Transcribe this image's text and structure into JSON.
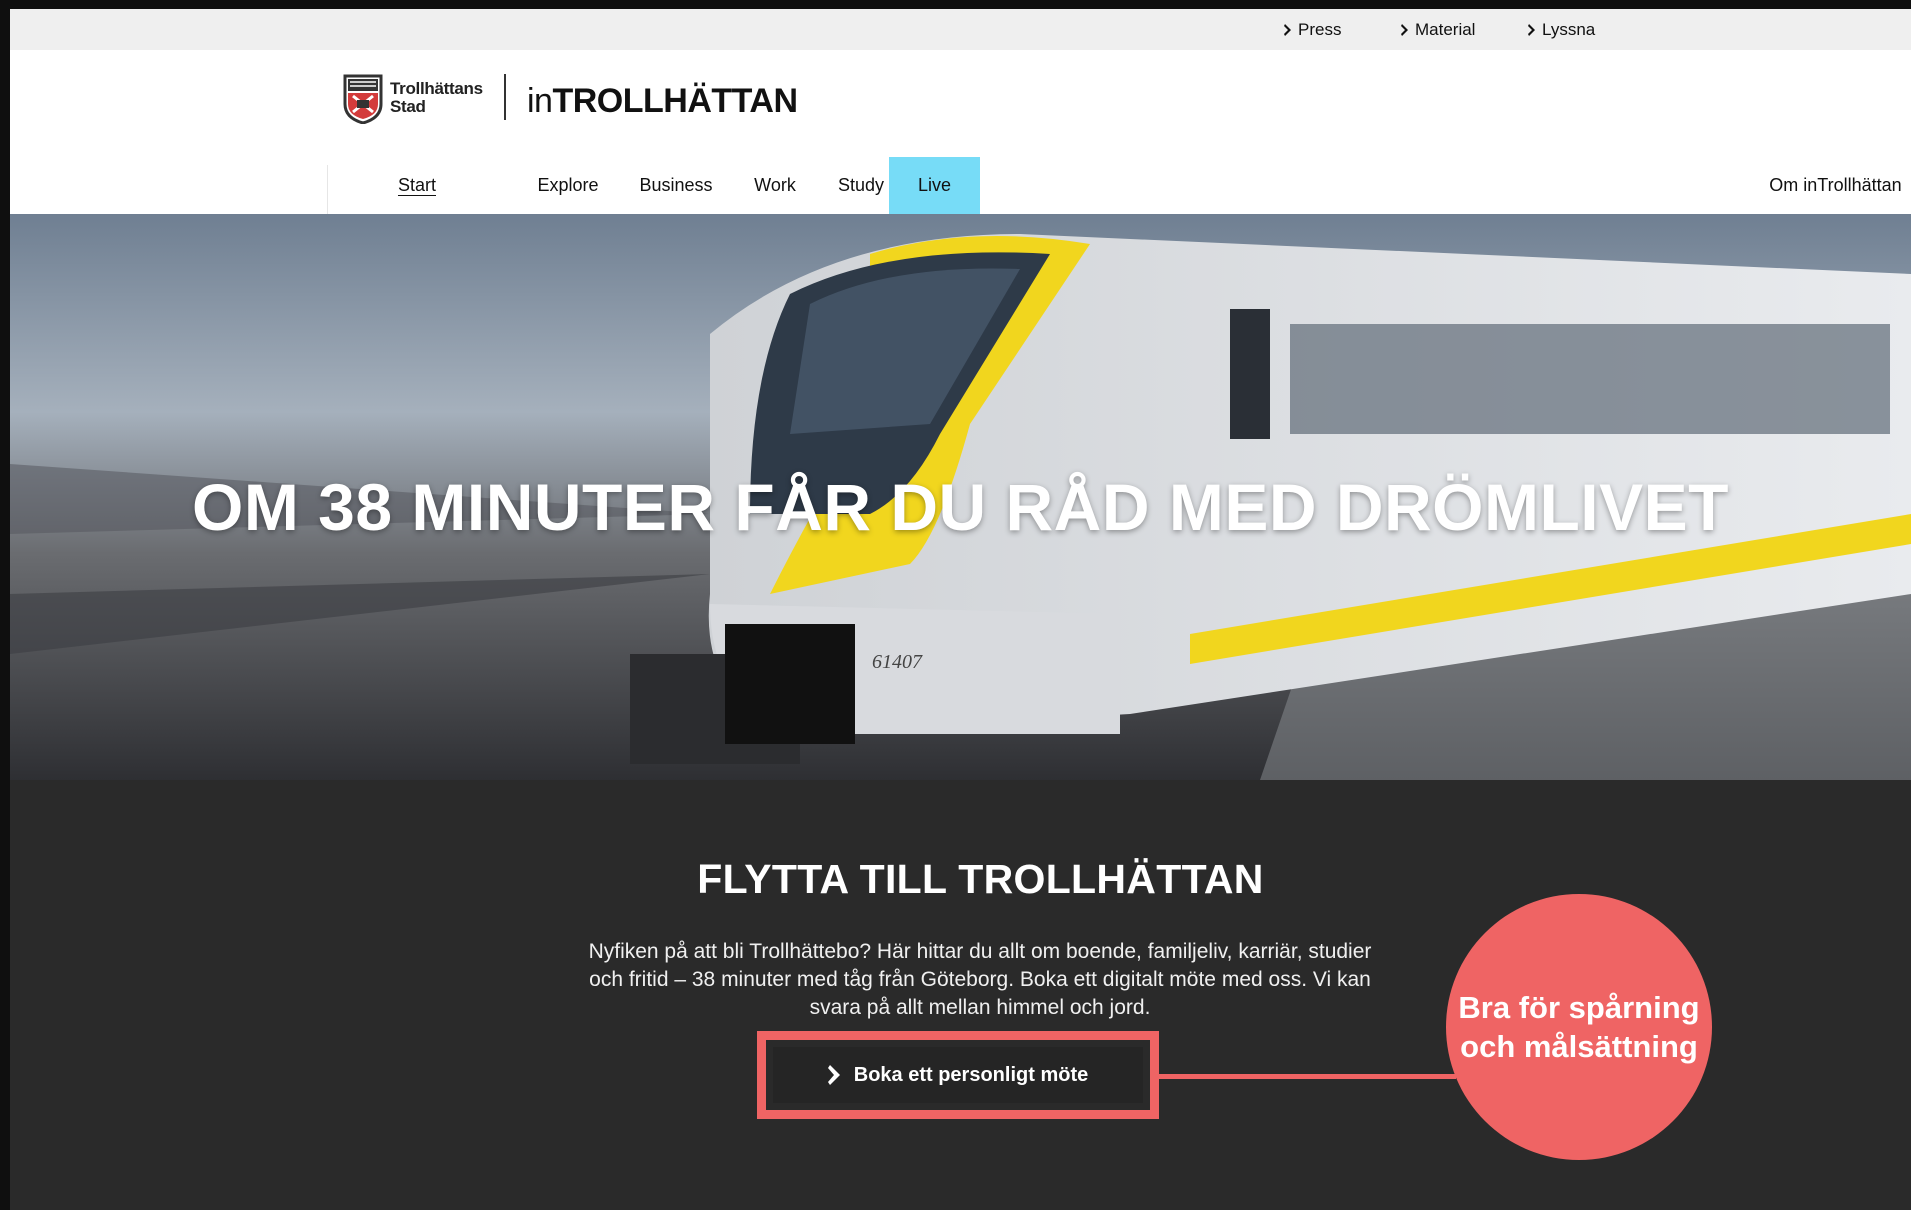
{
  "utility_nav": {
    "press": "Press",
    "material": "Material",
    "lyssna": "Lyssna"
  },
  "header": {
    "municipality_line1": "Trollhättans",
    "municipality_line2": "Stad",
    "brand_prefix": "in",
    "brand_name": "TROLLHÄTTAN"
  },
  "nav": {
    "items": [
      {
        "label": "Start"
      },
      {
        "label": "Explore"
      },
      {
        "label": "Business"
      },
      {
        "label": "Work"
      },
      {
        "label": "Study"
      },
      {
        "label": "Live"
      }
    ],
    "about": "Om inTrollhättan",
    "active_color": "#77dcf7"
  },
  "hero": {
    "title": "OM 38 MINUTER FÅR DU RÅD MED DRÖMLIVET",
    "train_number": "61407"
  },
  "section": {
    "title": "FLYTTA TILL TROLLHÄTTAN",
    "body": "Nyfiken på att bli Trollhättebo? Här hittar du allt om boende, familjeliv, karriär, studier och fritid – 38 minuter med tåg från Göteborg. Boka ett digitalt möte med oss. Vi kan svara på allt mellan himmel och jord.",
    "cta_label": "Boka ett personligt möte"
  },
  "annotation": {
    "callout_text": "Bra för spårning\noch målsättning",
    "color": "#ef6464"
  }
}
